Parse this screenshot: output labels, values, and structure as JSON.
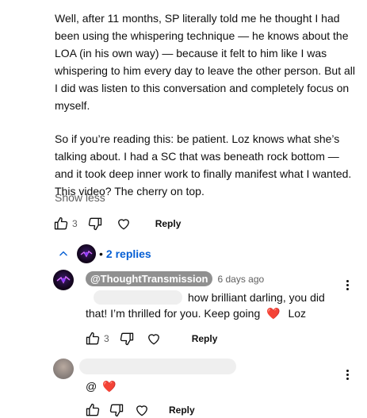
{
  "main_comment": {
    "paragraph1": "Well, after 11 months, SP literally told me he thought I had been using the whispering technique — he knows about the LOA (in his own way) — because it felt to him like I was whispering to him every day to leave the other person. But all I did was listen to this conversation and completely focus on myself.",
    "paragraph2": "So if you’re reading this: be patient. Loz knows what she’s talking about. I had a SC that was beneath rock bottom — and it took deep inner work to finally manifest what I wanted. This video? The cherry on top.",
    "show_less_label": "Show less",
    "like_count": "3",
    "reply_label": "Reply"
  },
  "replies_toggle": {
    "bullet": "•",
    "label": "2 replies"
  },
  "replies": [
    {
      "author": "@ThoughtTransmission",
      "time": "6 days ago",
      "text_line1": "how brilliant darling, you did",
      "text_line2": "that! I’m thrilled for you. Keep going",
      "heart": "❤️",
      "signoff": "Loz",
      "like_count": "3",
      "reply_label": "Reply"
    },
    {
      "text_prefix": "@",
      "heart": "❤️",
      "reply_label": "Reply"
    }
  ],
  "colors": {
    "link_blue": "#065fd4",
    "secondary_text": "#606060",
    "handle_bg": "#909090"
  }
}
